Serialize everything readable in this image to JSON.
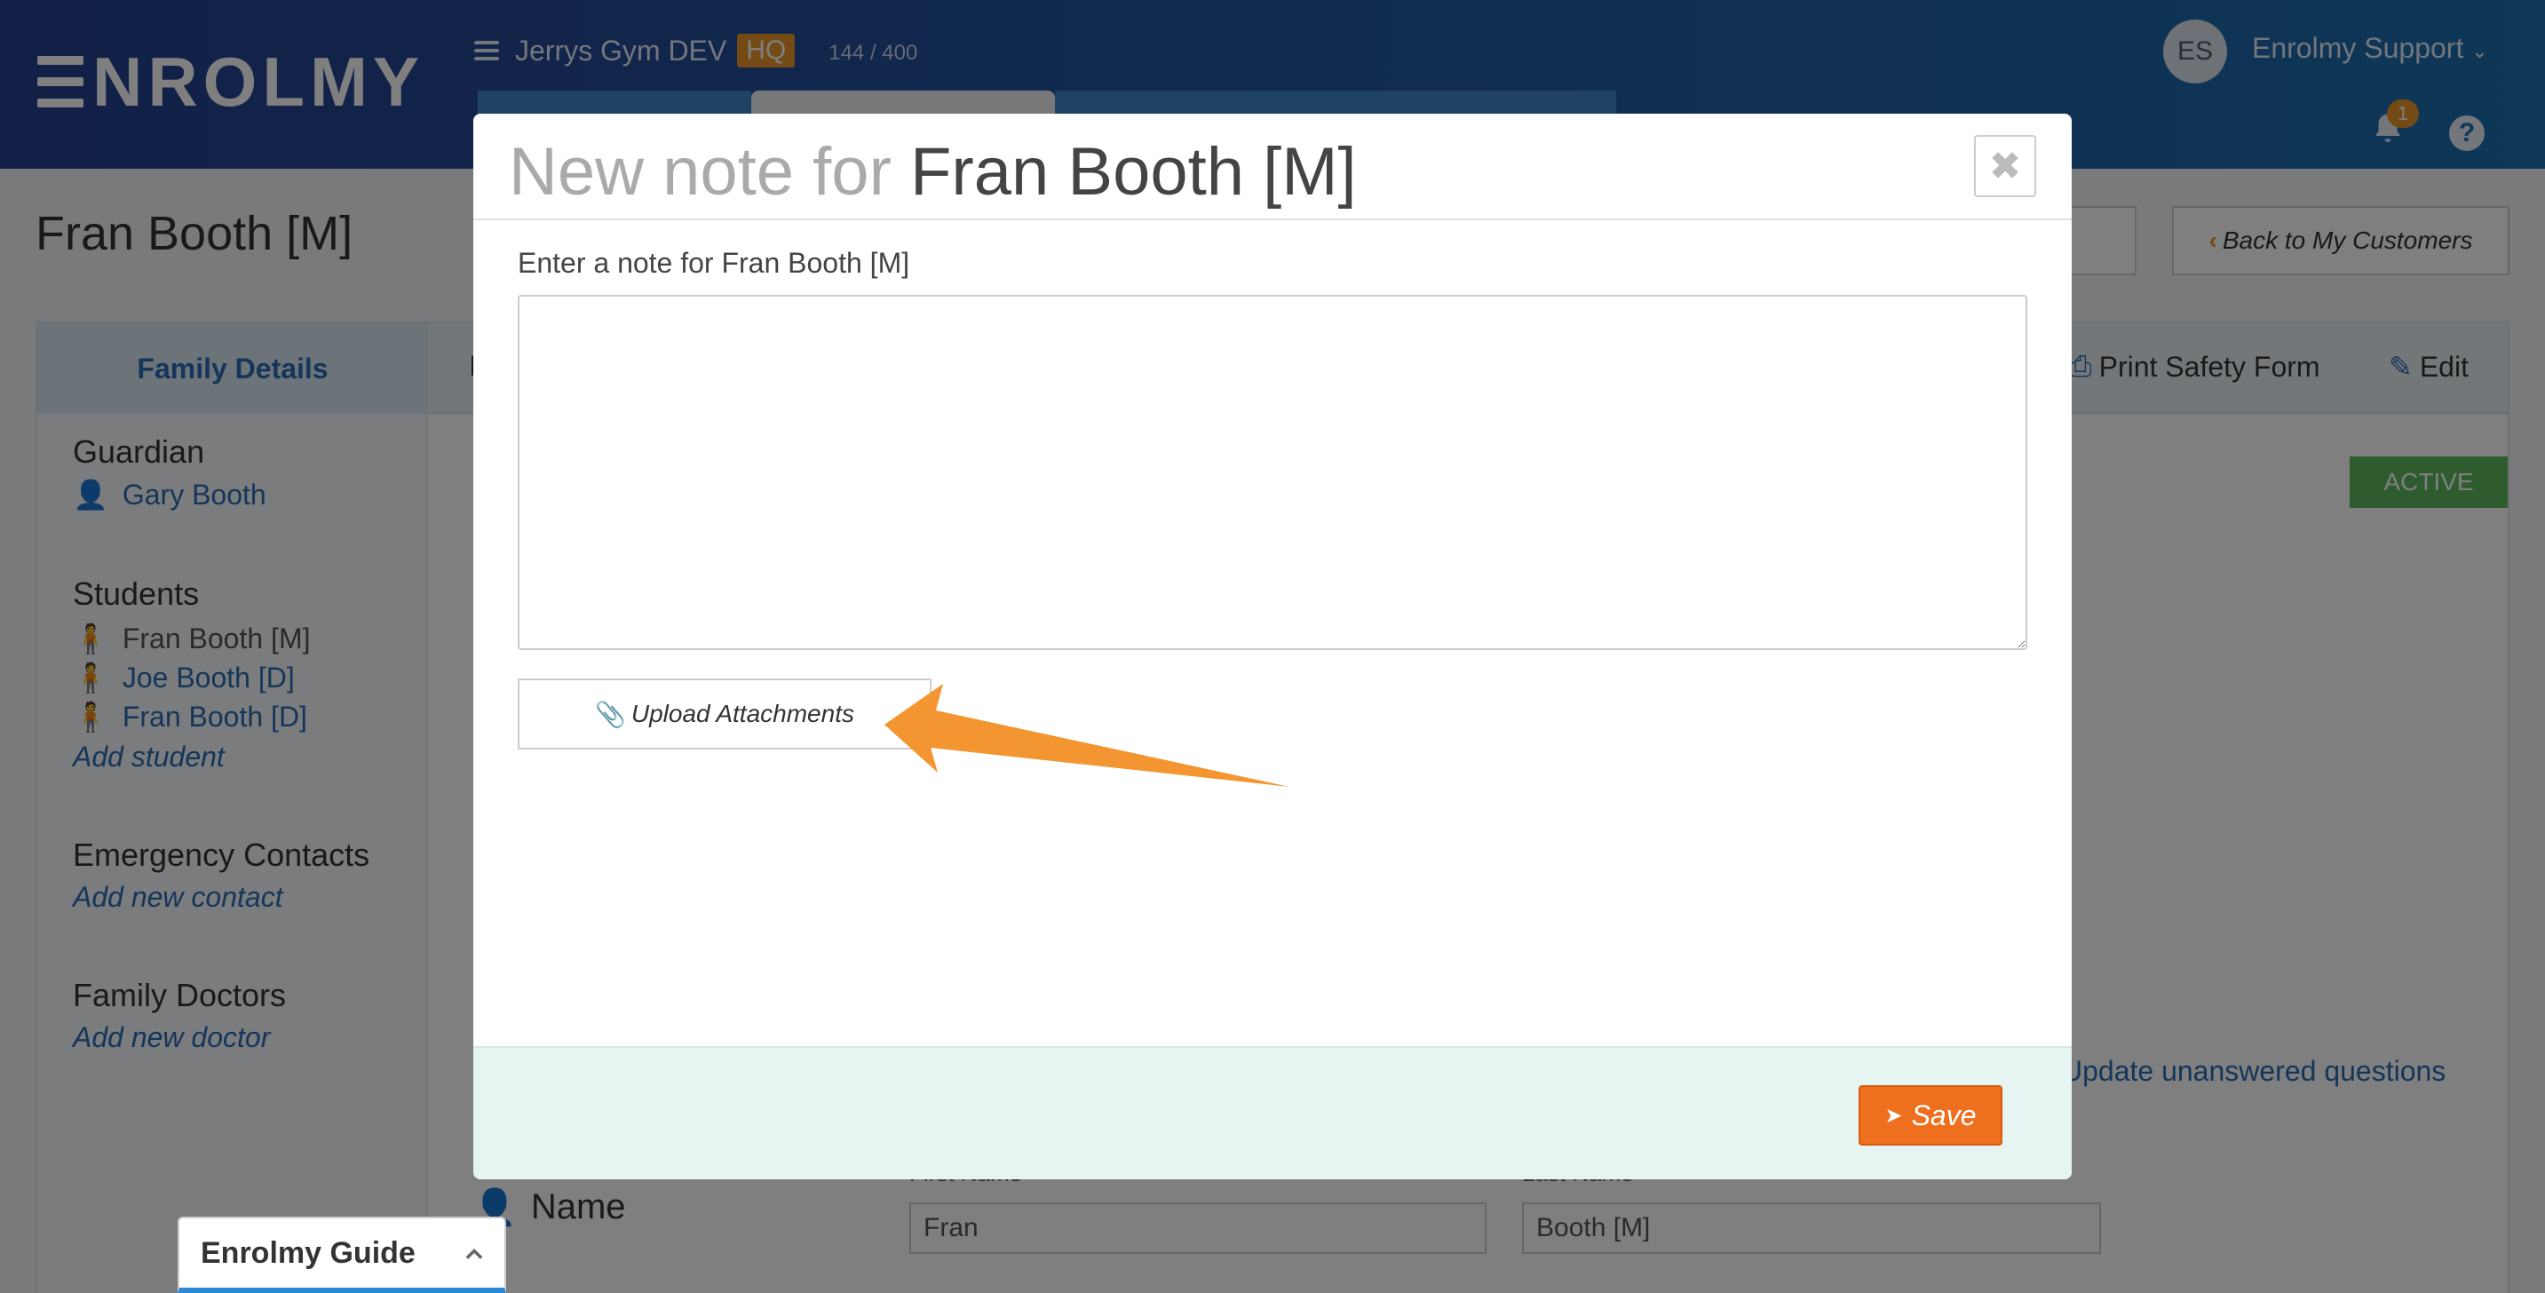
{
  "app": {
    "logo_text": "NROLMY",
    "gym_name": "Jerrys Gym DEV",
    "hq_badge": "HQ",
    "count": "144 / 400",
    "user_initials": "ES",
    "user_name": "Enrolmy Support",
    "notification_count": "1",
    "help_label": "?"
  },
  "page": {
    "title": "Fran Booth [M]",
    "back_button": "Back to My Customers",
    "tabs": {
      "family_details": "Family Details",
      "middle_tab": "I",
      "print": "Print Safety Form",
      "edit": "Edit"
    },
    "status_badge": "ACTIVE",
    "sidebar": {
      "guardian_heading": "Guardian",
      "guardian_name": "Gary Booth",
      "students_heading": "Students",
      "students": [
        "Fran Booth [M]",
        "Joe Booth [D]",
        "Fran Booth [D]"
      ],
      "add_student": "Add student",
      "emergency_heading": "Emergency Contacts",
      "add_contact": "Add new contact",
      "doctors_heading": "Family Doctors",
      "add_doctor": "Add new doctor"
    },
    "update_link": "Update unanswered questions",
    "name_section": {
      "label": "Name",
      "first_name_label": "First Name",
      "first_name_value": "Fran",
      "last_name_label": "Last Name",
      "last_name_value": "Booth  [M]"
    }
  },
  "modal": {
    "title_prefix": "New note for ",
    "title_name": "Fran Booth [M]",
    "close_label": "✖",
    "note_label": "Enter a note for Fran Booth [M]",
    "note_value": "",
    "upload_button": "Upload Attachments",
    "save_button": "Save"
  },
  "guide": {
    "label": "Enrolmy Guide"
  },
  "colors": {
    "accent_orange": "#ee6f1e",
    "link_blue": "#2a6cb5",
    "header_blue": "#25408f",
    "arrow_orange": "#f39530"
  }
}
